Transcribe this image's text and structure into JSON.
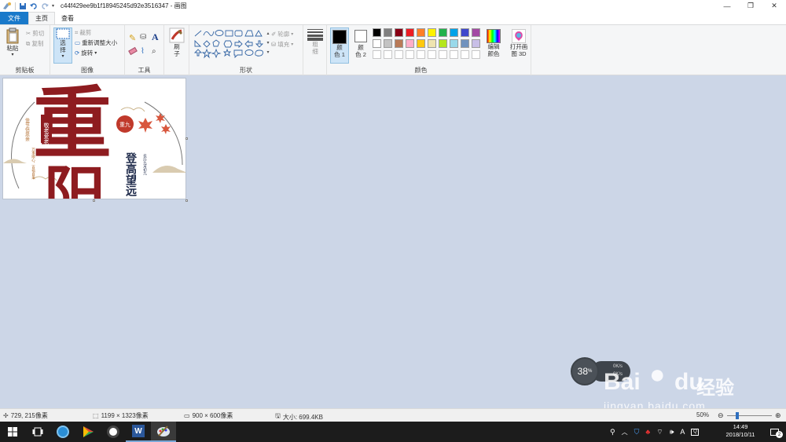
{
  "window": {
    "title": "c44f429ee9b1f18945245d92e3516347 - 画图",
    "controls": {
      "minimize": "—",
      "maximize": "❐",
      "close": "✕"
    }
  },
  "tabs": [
    {
      "label": "文件"
    },
    {
      "label": "主页"
    },
    {
      "label": "查看"
    }
  ],
  "ribbon": {
    "clipboard": {
      "paste": "粘贴",
      "cut": "剪切",
      "copy": "复制",
      "label": "剪贴板"
    },
    "image": {
      "select": "选\n择",
      "crop": "裁剪",
      "resize": "重新调整大小",
      "rotate": "旋转",
      "label": "图像"
    },
    "tools": {
      "label": "工具"
    },
    "brushes": {
      "label": "刷\n子"
    },
    "shapes": {
      "outline": "轮廓",
      "fill": "填充",
      "label": "形状"
    },
    "size": {
      "label": "粗\n细"
    },
    "colors": {
      "color1": "颜\n色 1",
      "color2": "颜\n色 2",
      "edit": "编辑\n颜色",
      "paint3d": "打开画\n图 3D",
      "label": "颜色",
      "color1_value": "#000000",
      "color2_value": "#ffffff",
      "palette_row1": [
        "#000000",
        "#7f7f7f",
        "#880015",
        "#ed1c24",
        "#ff7f27",
        "#fff200",
        "#22b14c",
        "#00a2e8",
        "#3f48cc",
        "#a349a4"
      ],
      "palette_row2": [
        "#ffffff",
        "#c3c3c3",
        "#b97a57",
        "#ffaec9",
        "#ffc90e",
        "#efe4b0",
        "#b5e61d",
        "#99d9ea",
        "#7092be",
        "#c8bfe7"
      ],
      "palette_row3": [
        "#ffffff",
        "#ffffff",
        "#ffffff",
        "#ffffff",
        "#ffffff",
        "#ffffff",
        "#ffffff",
        "#ffffff",
        "#ffffff",
        "#ffffff"
      ]
    }
  },
  "canvas_image": {
    "big_char_top": "重",
    "big_char_bottom": "阳",
    "stamp": "敬老爱老",
    "seal": "重九",
    "left_vertical": "佳节倍思亲",
    "right_title": "登高望远",
    "left_vertical2": "万事顺心，百福自来",
    "right_vertical": "农历九月初九"
  },
  "widget": {
    "percent": "38",
    "percent_unit": "%",
    "up_speed": "0K/s",
    "down_speed": "0K/s"
  },
  "watermark": {
    "brand": "Bai",
    "brand2": "du",
    "cn": "经验",
    "url": "jingyan.baidu.com"
  },
  "status": {
    "cursor": "729, 215像素",
    "selection": "1199 × 1323像素",
    "image_size": "900 × 600像素",
    "file_size": "大小: 699.4KB",
    "zoom": "50%"
  },
  "taskbar": {
    "time": "14:49",
    "date": "2018/10/11",
    "ime": "A",
    "notifications": "2"
  }
}
